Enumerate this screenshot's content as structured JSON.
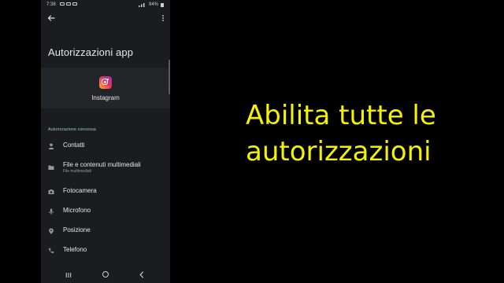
{
  "status_bar": {
    "time": "7:38",
    "battery": "94%"
  },
  "page": {
    "title": "Autorizzazioni app"
  },
  "app": {
    "name": "Instagram"
  },
  "section": {
    "header": "Autorizzazione concessa"
  },
  "permissions": [
    {
      "label": "Contatti",
      "subtitle": "",
      "icon": "person-icon"
    },
    {
      "label": "File e contenuti multimediali",
      "subtitle": "File multimediali",
      "icon": "folder-icon"
    },
    {
      "label": "Fotocamera",
      "subtitle": "",
      "icon": "camera-icon"
    },
    {
      "label": "Microfono",
      "subtitle": "",
      "icon": "microphone-icon"
    },
    {
      "label": "Posizione",
      "subtitle": "",
      "icon": "location-pin-icon"
    },
    {
      "label": "Telefono",
      "subtitle": "",
      "icon": "phone-icon"
    }
  ],
  "caption": {
    "line1": "Abilita tutte le",
    "line2": "autorizzazioni"
  },
  "colors": {
    "caption": "#f5f200",
    "section_header": "#8fc6d8",
    "screen_bg": "#1a1c1e"
  }
}
